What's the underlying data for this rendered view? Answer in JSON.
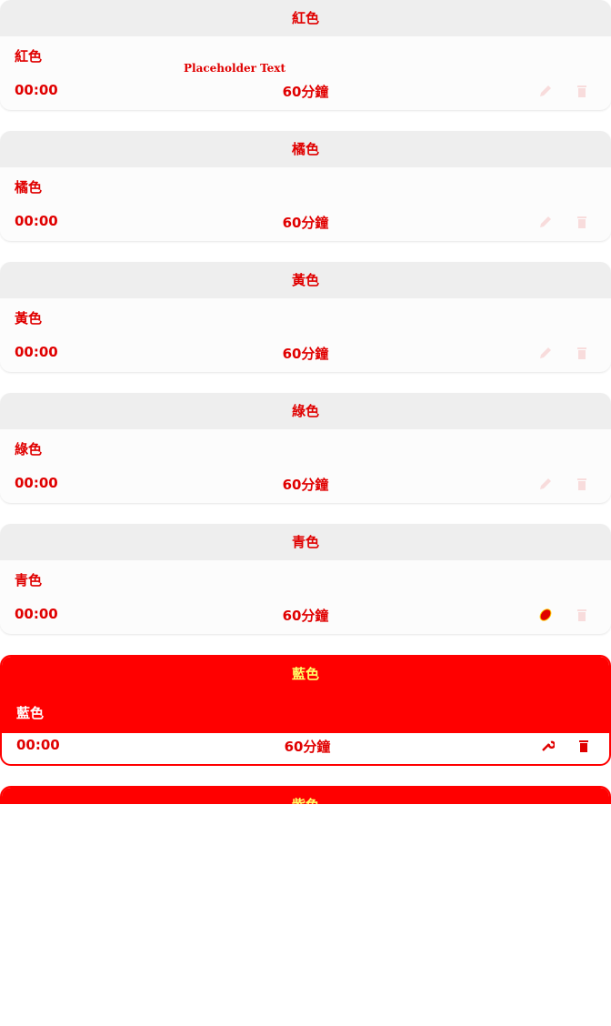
{
  "placeholder_text": "Placeholder Text",
  "entries": [
    {
      "header": "紅色",
      "name": "紅色",
      "time": "00:00",
      "duration": "60分鐘"
    },
    {
      "header": "橘色",
      "name": "橘色",
      "time": "00:00",
      "duration": "60分鐘"
    },
    {
      "header": "黃色",
      "name": "黃色",
      "time": "00:00",
      "duration": "60分鐘"
    },
    {
      "header": "綠色",
      "name": "綠色",
      "time": "00:00",
      "duration": "60分鐘"
    },
    {
      "header": "青色",
      "name": "青色",
      "time": "00:00",
      "duration": "60分鐘"
    },
    {
      "header": "藍色",
      "name": "藍色",
      "time": "00:00",
      "duration": "60分鐘"
    },
    {
      "header": "紫色"
    }
  ],
  "icons": {
    "edit": "pencil-icon",
    "delete": "trash-icon"
  },
  "colors": {
    "accent": "#ff0000",
    "text": "#e00000",
    "header_text_selected": "#ffff66"
  }
}
